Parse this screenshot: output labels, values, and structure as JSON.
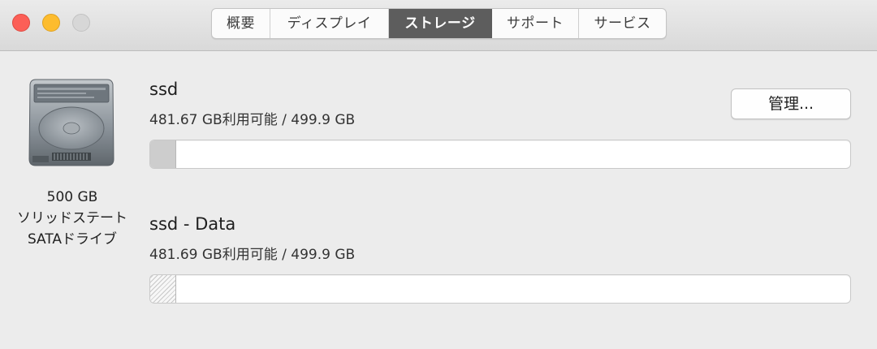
{
  "window": {
    "traffic_lights": [
      "close",
      "minimize",
      "zoom-disabled"
    ]
  },
  "tabs": [
    {
      "label": "概要",
      "active": false
    },
    {
      "label": "ディスプレイ",
      "active": false
    },
    {
      "label": "ストレージ",
      "active": true
    },
    {
      "label": "サポート",
      "active": false
    },
    {
      "label": "サービス",
      "active": false
    }
  ],
  "disk": {
    "icon": "hard-drive-icon",
    "capacity": "500 GB",
    "type_line1": "ソリッドステート",
    "type_line2": "SATAドライブ"
  },
  "volumes": [
    {
      "name": "ssd",
      "available": "481.67 GB利用可能 / 499.9 GB",
      "used_fraction": 0.036,
      "fill_style": "solid"
    },
    {
      "name": "ssd - Data",
      "available": "481.69 GB利用可能 / 499.9 GB",
      "used_fraction": 0.036,
      "fill_style": "striped"
    }
  ],
  "manage_button": {
    "label": "管理..."
  },
  "colors": {
    "active_tab": "#5d5d5d",
    "close": "#fc5f57",
    "minimize": "#fdbc2e",
    "zoom_disabled": "#d7d7d7"
  }
}
